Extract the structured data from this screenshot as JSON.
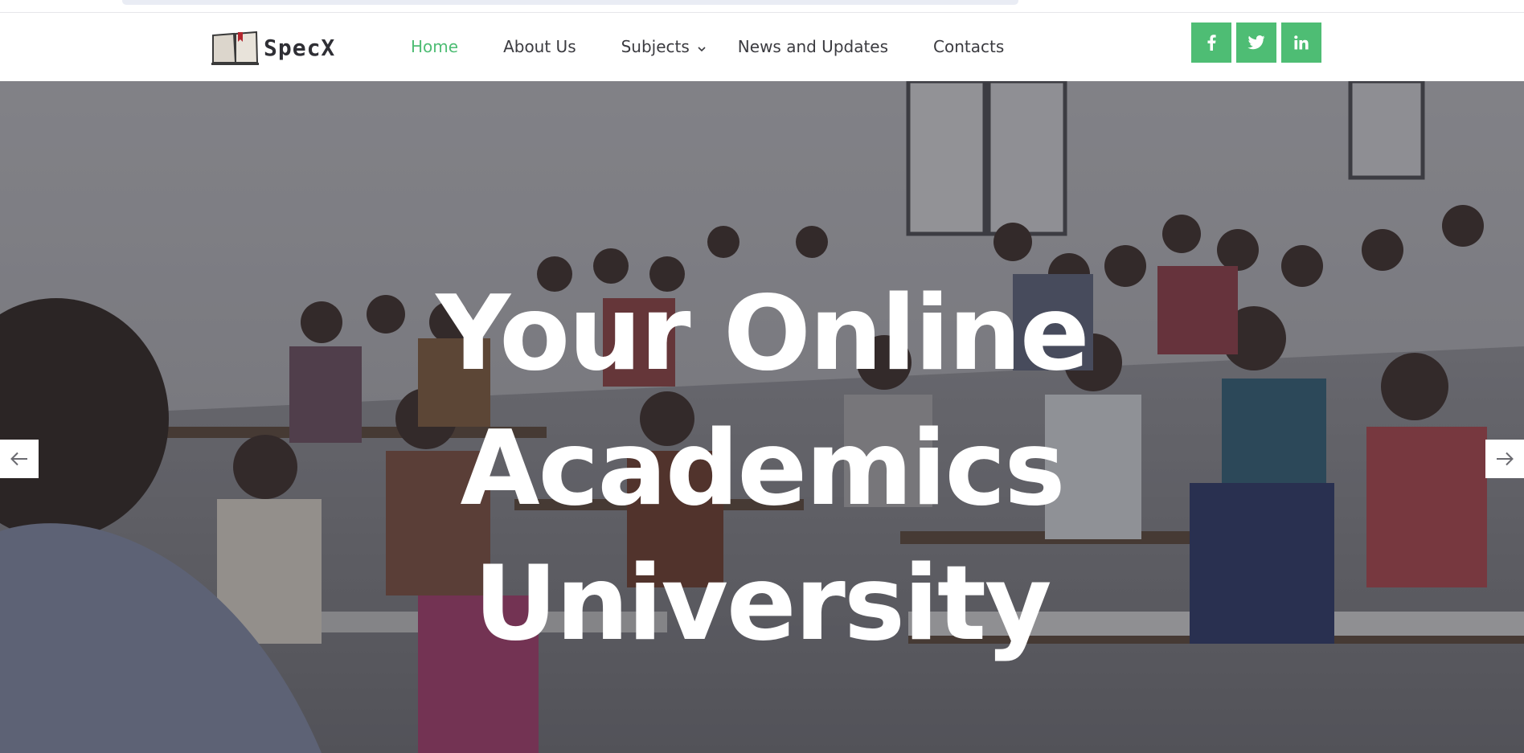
{
  "header": {
    "logo_text": "SpecX"
  },
  "nav": {
    "items": [
      {
        "label": "Home",
        "active": true
      },
      {
        "label": "About Us",
        "active": false
      },
      {
        "label": "Subjects",
        "active": false,
        "has_dropdown": true
      },
      {
        "label": "News and Updates",
        "active": false
      },
      {
        "label": "Contacts",
        "active": false
      }
    ]
  },
  "socials": [
    {
      "icon": "facebook-icon"
    },
    {
      "icon": "twitter-icon"
    },
    {
      "icon": "linkedin-icon"
    }
  ],
  "hero": {
    "title_line_1": "Your Online",
    "title_line_2": "Academics",
    "title_line_3": "University",
    "prev_icon": "arrow-left-icon",
    "next_icon": "arrow-right-icon"
  },
  "colors": {
    "accent": "#4ebd74",
    "nav_text": "#3b3b40",
    "hero_text": "#ffffff"
  }
}
